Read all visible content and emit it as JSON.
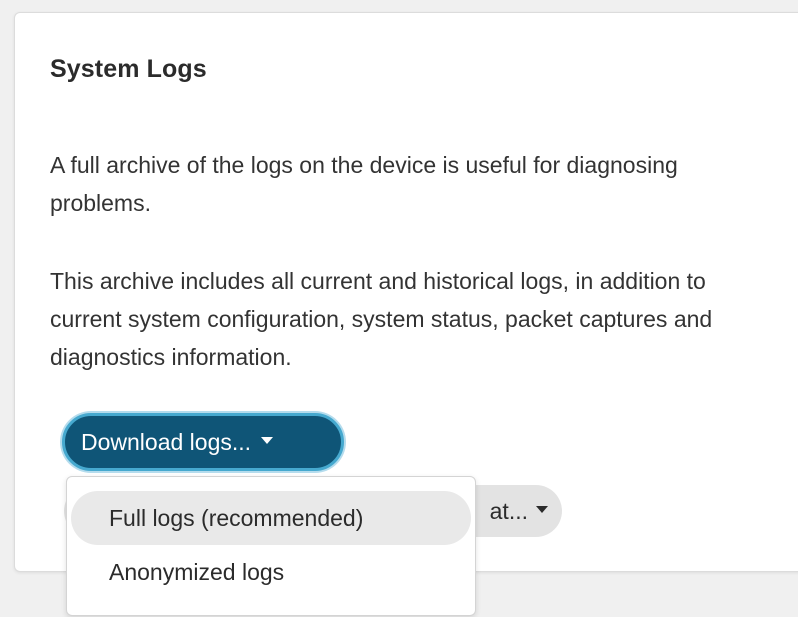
{
  "card": {
    "title": "System Logs",
    "paragraph_1": "A full archive of the logs on the device is useful for diagnosing problems.",
    "paragraph_2": "This archive includes all current and historical logs, in addition to current system configuration, system status, packet captures and diagnostics information."
  },
  "download_button": {
    "label": "Download logs...",
    "icon": "caret-down-icon"
  },
  "format_button": {
    "visible_label": "at...",
    "icon": "caret-down-icon"
  },
  "dropdown_menu": {
    "items": [
      {
        "label": "Full logs (recommended)",
        "highlighted": true
      },
      {
        "label": "Anonymized logs",
        "highlighted": false
      }
    ]
  },
  "colors": {
    "primary_button": "#0f5577",
    "focus_ring": "#46a9cf",
    "secondary_button": "#e3e3e3",
    "menu_highlight": "#e9e9e9"
  }
}
